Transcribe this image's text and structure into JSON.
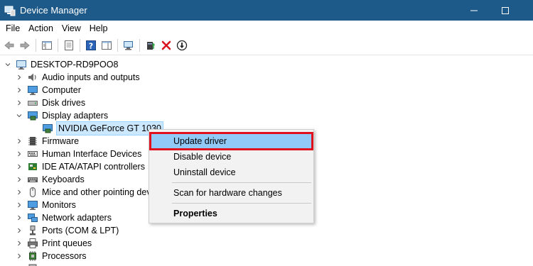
{
  "window": {
    "title": "Device Manager"
  },
  "menu": [
    "File",
    "Action",
    "View",
    "Help"
  ],
  "toolbar": {
    "buttons": [
      "back-icon",
      "forward-icon",
      "show-hide-console-tree-icon",
      "properties-icon",
      "help-icon",
      "action-pane-icon",
      "scan-hardware-icon",
      "update-driver-icon",
      "uninstall-icon",
      "disable-device-icon"
    ]
  },
  "tree": {
    "root": "DESKTOP-RD9POO8",
    "categories": [
      "Audio inputs and outputs",
      "Computer",
      "Disk drives",
      "Display adapters",
      "NVIDIA GeForce GT 1030",
      "Firmware",
      "Human Interface Devices",
      "IDE ATA/ATAPI controllers",
      "Keyboards",
      "Mice and other pointing dev",
      "Monitors",
      "Network adapters",
      "Ports (COM & LPT)",
      "Print queues",
      "Processors"
    ]
  },
  "context_menu": {
    "items": [
      "Update driver",
      "Disable device",
      "Uninstall device",
      "Scan for hardware changes",
      "Properties"
    ]
  },
  "colors": {
    "titlebar": "#1d5a8a",
    "selection": "#cce8ff",
    "menu_highlight": "#91c9f7",
    "highlight_border": "#e0101c"
  }
}
